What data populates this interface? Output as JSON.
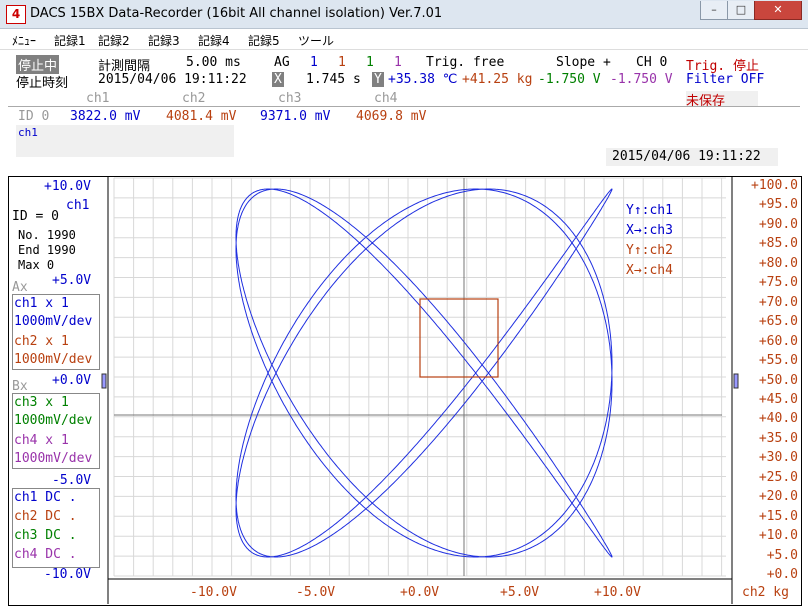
{
  "window": {
    "title": "DACS 15BX Data-Recorder (16bit All channel isolation) Ver.7.01",
    "icon_text": "4",
    "buttons": {
      "minimize": "–",
      "maximize": "□",
      "close": "✕"
    }
  },
  "menu": [
    "ﾒﾆｭｰ",
    "記録1",
    "記録2",
    "記録3",
    "記録4",
    "記録5",
    "ツール"
  ],
  "status": {
    "state": "停止中",
    "interval_label": "計測間隔",
    "interval_value": "5.00 ms",
    "ag_label": "AG",
    "ag_values": [
      "1",
      "1",
      "1",
      "1"
    ],
    "trig_mode": "Trig. free",
    "slope": "Slope +",
    "ch": "CH 0",
    "trig_stop": "Trig. 停止",
    "stop_time_label": "停止時刻",
    "stop_time": "2015/04/06 19:11:22",
    "x_label": "X",
    "x_value": "1.745 s",
    "y_label": "Y",
    "y_ch1": "+35.38 ℃",
    "y_ch2": "+41.25 kg",
    "y_ch3": "-1.750 V",
    "y_ch4": "-1.750 V",
    "filter": "Filter OFF",
    "unsaved": "未保存"
  },
  "channels": {
    "headers": [
      "ch1",
      "ch2",
      "ch3",
      "ch4"
    ],
    "id_label": "ID 0",
    "values": [
      "3822.0 mV",
      "4081.4 mV",
      "9371.0 mV",
      "4069.8 mV"
    ],
    "colors": [
      "#0000cc",
      "#b84010",
      "#0000cc",
      "#b84010"
    ],
    "selected": "ch1",
    "timestamp": "2015/04/06 19:11:22"
  },
  "left_panel": {
    "top_scale": "+10.0V",
    "ch_name": "ch1",
    "id": "ID = 0",
    "no": "No.  1990",
    "end": "End  1990",
    "max": "Max     0",
    "s_plus5": "+5.0V",
    "ax_label": "Ax",
    "ax_rows": [
      {
        "a": "ch1 x    1",
        "b": "1000mV/dev"
      },
      {
        "a": "ch2 x    1",
        "b": "1000mV/dev"
      }
    ],
    "s_zero": "+0.0V",
    "bx_label": "Bx",
    "bx_rows": [
      {
        "a": "ch3 x    1",
        "b": "1000mV/dev"
      },
      {
        "a": "ch4 x    1",
        "b": "1000mV/dev"
      }
    ],
    "s_minus5": "-5.0V",
    "dc_rows": [
      "ch1 DC   .",
      "ch2 DC   .",
      "ch3 DC   .",
      "ch4 DC   ."
    ],
    "s_minus10": "-10.0V"
  },
  "legend": [
    "Y↑:ch1",
    "X→:ch3",
    "Y↑:ch2",
    "X→:ch4"
  ],
  "right_axis": [
    "+100.0",
    "+95.0",
    "+90.0",
    "+85.0",
    "+80.0",
    "+75.0",
    "+70.0",
    "+65.0",
    "+60.0",
    "+55.0",
    "+50.0",
    "+45.0",
    "+40.0",
    "+35.0",
    "+30.0",
    "+25.0",
    "+20.0",
    "+15.0",
    "+10.0",
    "+5.0",
    "+0.0"
  ],
  "right_unit": "ch2  kg",
  "bottom_axis": [
    "-10.0V",
    "-5.0V",
    "+0.0V",
    "+5.0V",
    "+10.0V"
  ],
  "colors": {
    "trace": "#1f2fe0",
    "box": "#b84010",
    "grid": "#d8d8d8"
  }
}
